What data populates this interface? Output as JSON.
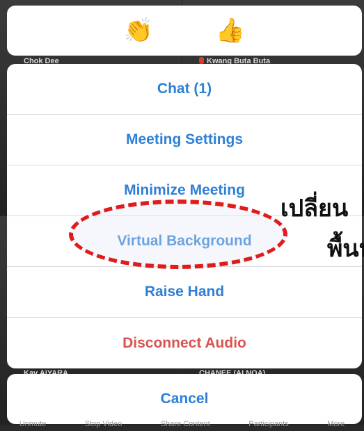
{
  "background": {
    "participants": [
      {
        "name": "Chok Dee"
      },
      {
        "name": "Kwang Buta Buta"
      },
      {
        "name": "Kav AiYARA"
      },
      {
        "name": "CHANEE (AI NOA)"
      }
    ]
  },
  "reactions": {
    "items": [
      {
        "icon": "clapping-hands-icon",
        "glyph": "👏"
      },
      {
        "icon": "thumbs-up-icon",
        "glyph": "👍"
      }
    ]
  },
  "action_sheet": {
    "items": [
      {
        "label": "Chat (1)"
      },
      {
        "label": "Meeting Settings"
      },
      {
        "label": "Minimize Meeting"
      },
      {
        "label": "Virtual Background"
      },
      {
        "label": "Raise Hand"
      },
      {
        "label": "Disconnect Audio"
      }
    ],
    "cancel_label": "Cancel"
  },
  "toolbar": {
    "items": [
      "Unmute",
      "Stop Video",
      "Share Content",
      "Participants",
      "More"
    ]
  },
  "annotation": {
    "line1": "เปลี่ยน",
    "line2": "พื้นห"
  },
  "colors": {
    "accent": "#2f7fd6",
    "danger": "#d9534f",
    "highlight": "#e01b1b"
  }
}
